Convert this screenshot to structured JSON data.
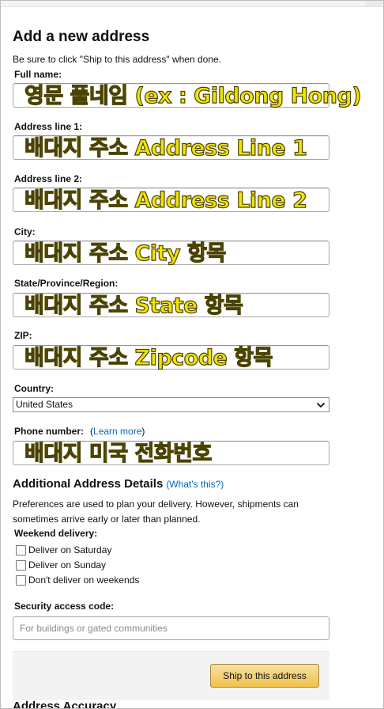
{
  "page_title": "Add a new address",
  "subtitle": "Be sure to click \"Ship to this address\" when done.",
  "fields": {
    "full_name": {
      "label": "Full name:",
      "overlay": "영문 풀네임 (ex : Gildong Hong)"
    },
    "address1": {
      "label": "Address line 1:",
      "overlay": "배대지 주소 Address Line 1"
    },
    "address2": {
      "label": "Address line 2:",
      "overlay": "배대지 주소 Address Line 2"
    },
    "city": {
      "label": "City:",
      "overlay": "배대지 주소 City 항목"
    },
    "state": {
      "label": "State/Province/Region:",
      "overlay": "배대지 주소 State 항목"
    },
    "zip": {
      "label": "ZIP:",
      "overlay": "배대지 주소 Zipcode 항목"
    },
    "country": {
      "label": "Country:",
      "value": "United States"
    },
    "phone": {
      "label": "Phone number:",
      "paren_open": "(",
      "link": "Learn more",
      "paren_close": ")",
      "overlay": "배대지 미국 전화번호"
    }
  },
  "additional": {
    "heading": "Additional Address Details",
    "link": "(What's this?)",
    "description": "Preferences are used to plan your delivery. However, shipments can sometimes arrive early or later than planned.",
    "weekend_label": "Weekend delivery:",
    "options": [
      "Deliver on Saturday",
      "Deliver on Sunday",
      "Don't deliver on weekends"
    ],
    "security_label": "Security access code:",
    "security_placeholder": "For buildings or gated communities"
  },
  "submit_label": "Ship to this address",
  "next_section": "Address Accuracy",
  "colors": {
    "overlay_text": "#f2e400",
    "link": "#0066c0",
    "button": "#f0c14b"
  }
}
